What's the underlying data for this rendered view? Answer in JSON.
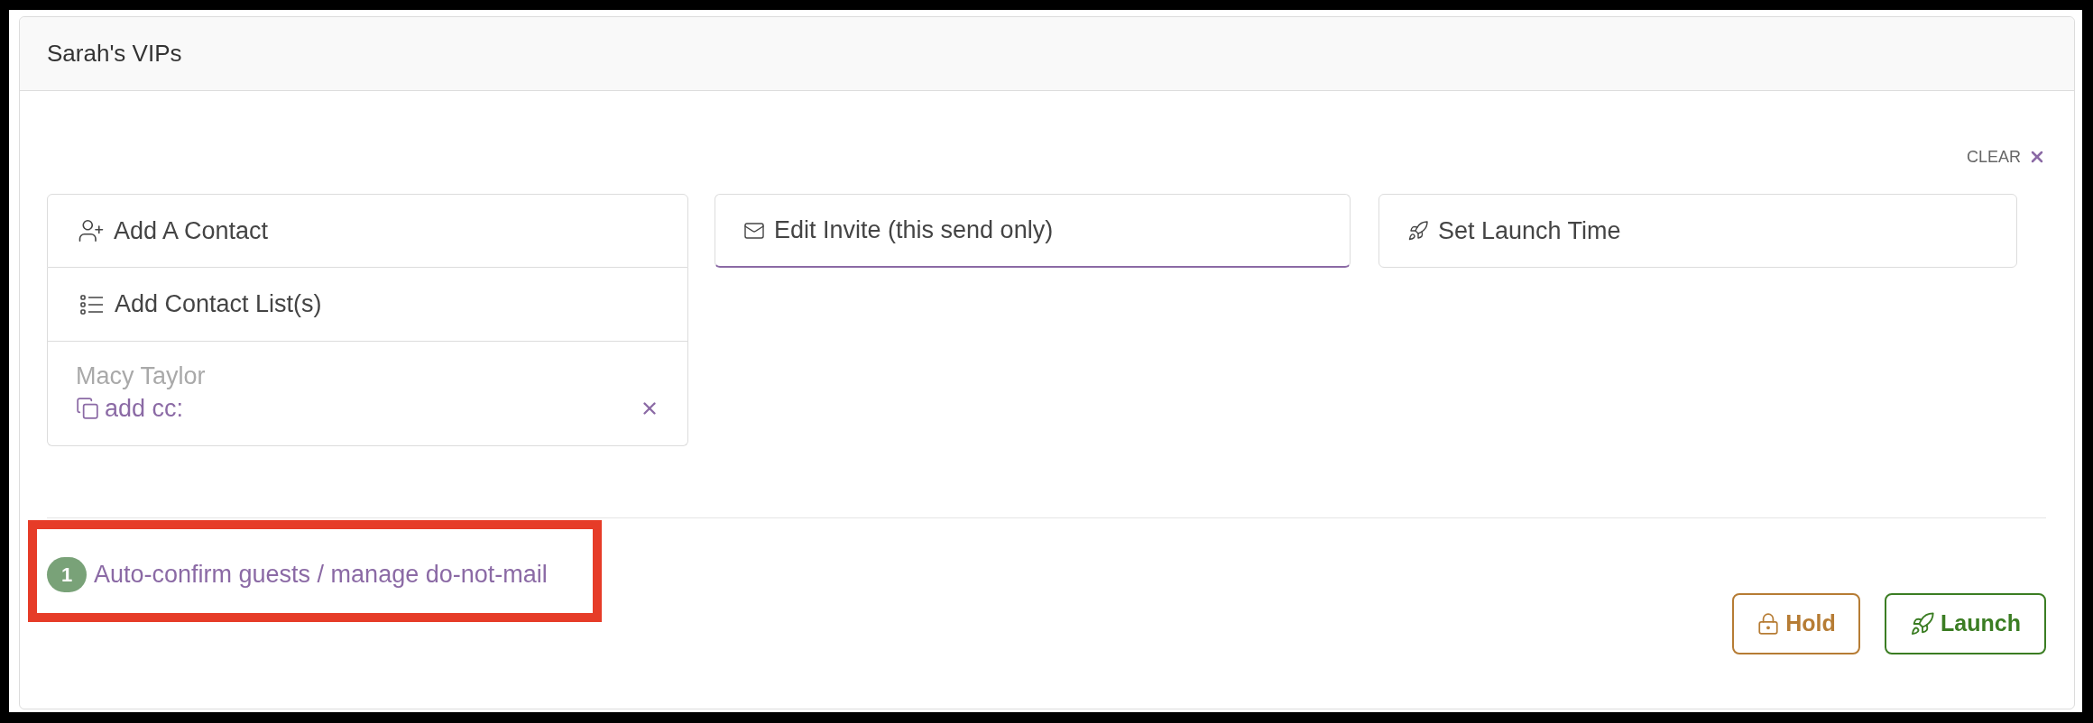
{
  "panel": {
    "title": "Sarah's VIPs",
    "clear": "CLEAR"
  },
  "recipients": {
    "add_contact": "Add A Contact",
    "add_list": "Add Contact List(s)",
    "contacts": [
      {
        "name": "Macy Taylor",
        "cc": "add cc:"
      }
    ]
  },
  "steps": [
    {
      "kind": "invite",
      "label": "Edit Invite (this send only)",
      "active": true
    },
    {
      "kind": "schedule",
      "label": "Set Launch Time",
      "active": false
    }
  ],
  "footer": {
    "badge": "1",
    "link": "Auto-confirm guests / manage do-not-mail",
    "highlighted": true
  },
  "buttons": [
    {
      "kind": "hold",
      "label": "Hold"
    },
    {
      "kind": "launch",
      "label": "Launch"
    }
  ]
}
